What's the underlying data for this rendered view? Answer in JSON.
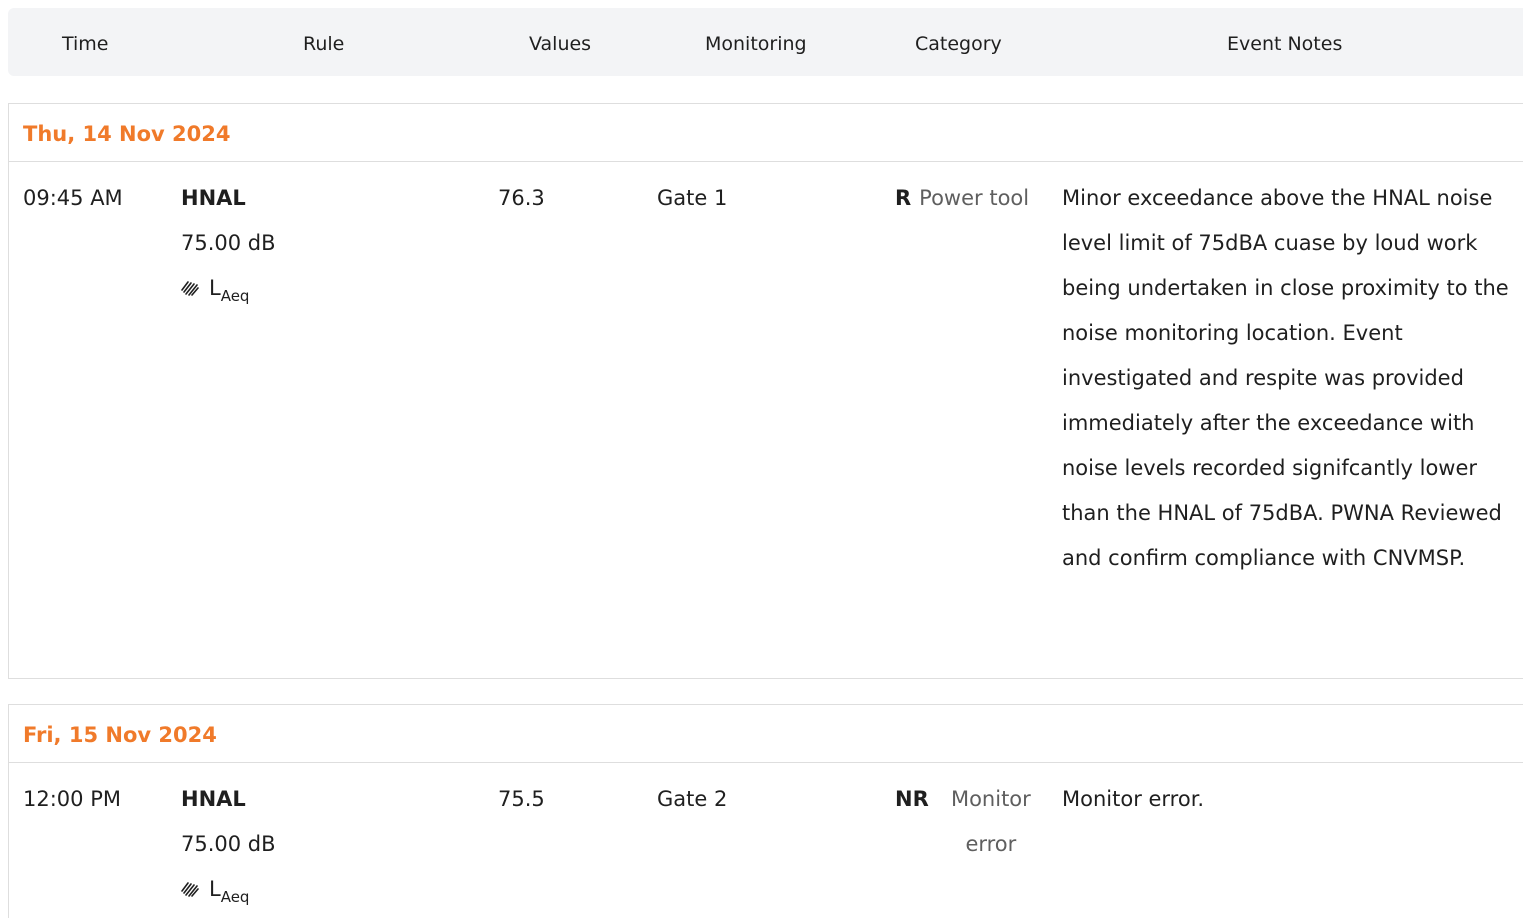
{
  "header": {
    "columns": {
      "time": "Time",
      "rule": "Rule",
      "values": "Values",
      "monitoring": "Monitoring",
      "category": "Category",
      "notes": "Event Notes"
    }
  },
  "groups": [
    {
      "date": "Thu, 14 Nov 2024",
      "row": {
        "time": "09:45 AM",
        "rule_name": "HNAL",
        "rule_limit": "75.00 dB",
        "metric_main": "L",
        "metric_sub": "Aeq",
        "value": "76.3",
        "monitoring": "Gate 1",
        "category_code": "R",
        "category_text": "Power tool",
        "notes": "Minor exceedance above the HNAL noise level limit of 75dBA cuase by loud work being undertaken in close proximity to the noise monitoring location. Event investigated and respite was provided immediately after the exceedance with noise levels recorded signifcantly lower than the HNAL of 75dBA. PWNA Reviewed and confirm compliance with CNVMSP."
      }
    },
    {
      "date": "Fri, 15 Nov 2024",
      "row": {
        "time": "12:00 PM",
        "rule_name": "HNAL",
        "rule_limit": "75.00 dB",
        "metric_main": "L",
        "metric_sub": "Aeq",
        "value": "75.5",
        "monitoring": "Gate 2",
        "category_code": "NR",
        "category_text": "Monitor error",
        "notes": "Monitor error."
      }
    }
  ],
  "colors": {
    "date_accent": "#f07a2a",
    "header_bg": "#f3f4f6",
    "border": "#dedede",
    "category_text": "#5f5f5f"
  },
  "icons": {
    "metric": "hatch-icon"
  }
}
